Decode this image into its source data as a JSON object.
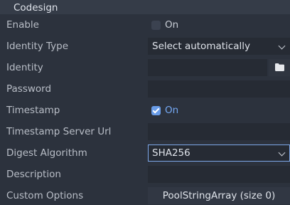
{
  "section": {
    "title": "Codesign"
  },
  "rows": {
    "enable": {
      "label": "Enable",
      "checkbox_text": "On",
      "checked": false
    },
    "identity_type": {
      "label": "Identity Type",
      "selected": "Select automatically"
    },
    "identity": {
      "label": "Identity",
      "value": "",
      "button_icon": "folder-icon"
    },
    "password": {
      "label": "Password",
      "value": ""
    },
    "timestamp": {
      "label": "Timestamp",
      "checkbox_text": "On",
      "checked": true
    },
    "timestamp_server_url": {
      "label": "Timestamp Server Url",
      "value": ""
    },
    "digest_algorithm": {
      "label": "Digest Algorithm",
      "selected": "SHA256"
    },
    "description": {
      "label": "Description",
      "value": ""
    },
    "custom_options": {
      "label": "Custom Options",
      "button_text": "PoolStringArray (size 0)"
    }
  },
  "colors": {
    "background": "#2c323d",
    "header": "#353c48",
    "field": "#262b34",
    "accent": "#699ce8",
    "focus_border": "#7da7e8"
  }
}
